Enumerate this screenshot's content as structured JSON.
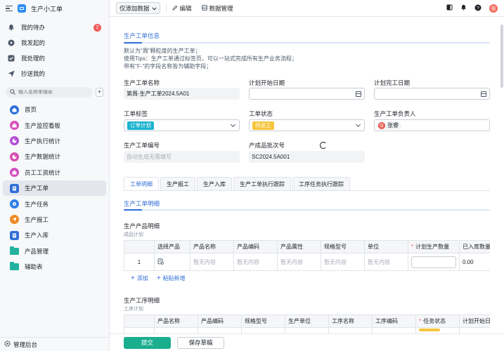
{
  "app": {
    "name": "生产小工单"
  },
  "quick_items": [
    {
      "label": "我的待办",
      "badge": "2"
    },
    {
      "label": "我发起的"
    },
    {
      "label": "我处理的"
    },
    {
      "label": "抄送我的"
    }
  ],
  "search": {
    "placeholder": "输入名称来搜索"
  },
  "nav_items": [
    {
      "label": "首页",
      "color": "#2f6ed8"
    },
    {
      "label": "生产监控看板",
      "color": "#d94fb8"
    },
    {
      "label": "生产执行统计",
      "color": "#b04fd4"
    },
    {
      "label": "生产数据统计",
      "color": "#d64fb0"
    },
    {
      "label": "员工工资统计",
      "color": "#d24fc0"
    },
    {
      "label": "生产工单",
      "color": "#2f6ed8"
    },
    {
      "label": "生产任务",
      "color": "#2f7ee8"
    },
    {
      "label": "生产报工",
      "color": "#f08a24"
    },
    {
      "label": "生产入库",
      "color": "#2f6ed8"
    },
    {
      "label": "产品管理",
      "color": "#23b2a0"
    },
    {
      "label": "辅助表",
      "color": "#23b2a0"
    }
  ],
  "sidebar_footer": {
    "label": "管理后台"
  },
  "toolbar": {
    "view_label": "仅添加数据",
    "edit_label": "编辑",
    "data_manage_label": "数据管理",
    "user_initial": "张"
  },
  "form": {
    "section_title": "生产工单信息",
    "description": [
      "默认为\"周\"颗粒度的生产工单；",
      "使用Tips：生产工单通过标签页，可以一站式完成所有生产业务流程；",
      "带有\"F-\"的字段名称皆为辅助字段；"
    ],
    "fields": {
      "order_name": {
        "label": "生产工单名称",
        "value": "第周-生产工单2024.5A01"
      },
      "plan_start": {
        "label": "计划开始日期",
        "value": ""
      },
      "plan_end": {
        "label": "计划完工日期",
        "value": ""
      },
      "order_tag": {
        "label": "工单标签",
        "value": "订单计划"
      },
      "order_status": {
        "label": "工单状态",
        "value": "待派工"
      },
      "owner": {
        "label": "生产工单负责人",
        "value": "张睿",
        "initial": "张"
      },
      "order_no": {
        "label": "生产工单编号",
        "placeholder": "自动生成无需填写"
      },
      "batch_no": {
        "label": "产成品批次号",
        "value": "SC2024.5A001"
      }
    }
  },
  "tabs": [
    {
      "label": "工单明细",
      "active": true
    },
    {
      "label": "生产报工"
    },
    {
      "label": "生产入库"
    },
    {
      "label": "生产工单执行跟踪"
    },
    {
      "label": "工序任务执行跟踪"
    }
  ],
  "detail": {
    "section_title": "生产工单明细",
    "product_table": {
      "title": "生产产品明细",
      "hint": "成品计划",
      "headers": [
        "",
        "选择产品",
        "产品名称",
        "产品编码",
        "产品属性",
        "规格型号",
        "单位",
        "计划生产数量",
        "已入库数量"
      ],
      "required": [
        false,
        false,
        false,
        false,
        false,
        false,
        false,
        true,
        false
      ],
      "rows": [
        {
          "index": "1",
          "name": "暂无内容",
          "code": "暂无内容",
          "attr": "暂无内容",
          "spec": "暂无内容",
          "unit": "暂无内容",
          "plan_qty": "",
          "stored_qty": "0.00"
        }
      ]
    },
    "add_label": "添加",
    "paste_label": "粘贴新增",
    "process_table": {
      "title": "生产工序明细",
      "hint": "工序计划",
      "headers": [
        "",
        "产品名称",
        "产品编码",
        "规格型号",
        "生产单位",
        "工序名称",
        "工序编码",
        "任务状态",
        "计划开始日"
      ],
      "required": [
        false,
        false,
        false,
        false,
        false,
        false,
        false,
        true,
        false
      ]
    }
  },
  "footer": {
    "submit_label": "提交",
    "save_draft_label": "保存草稿"
  }
}
